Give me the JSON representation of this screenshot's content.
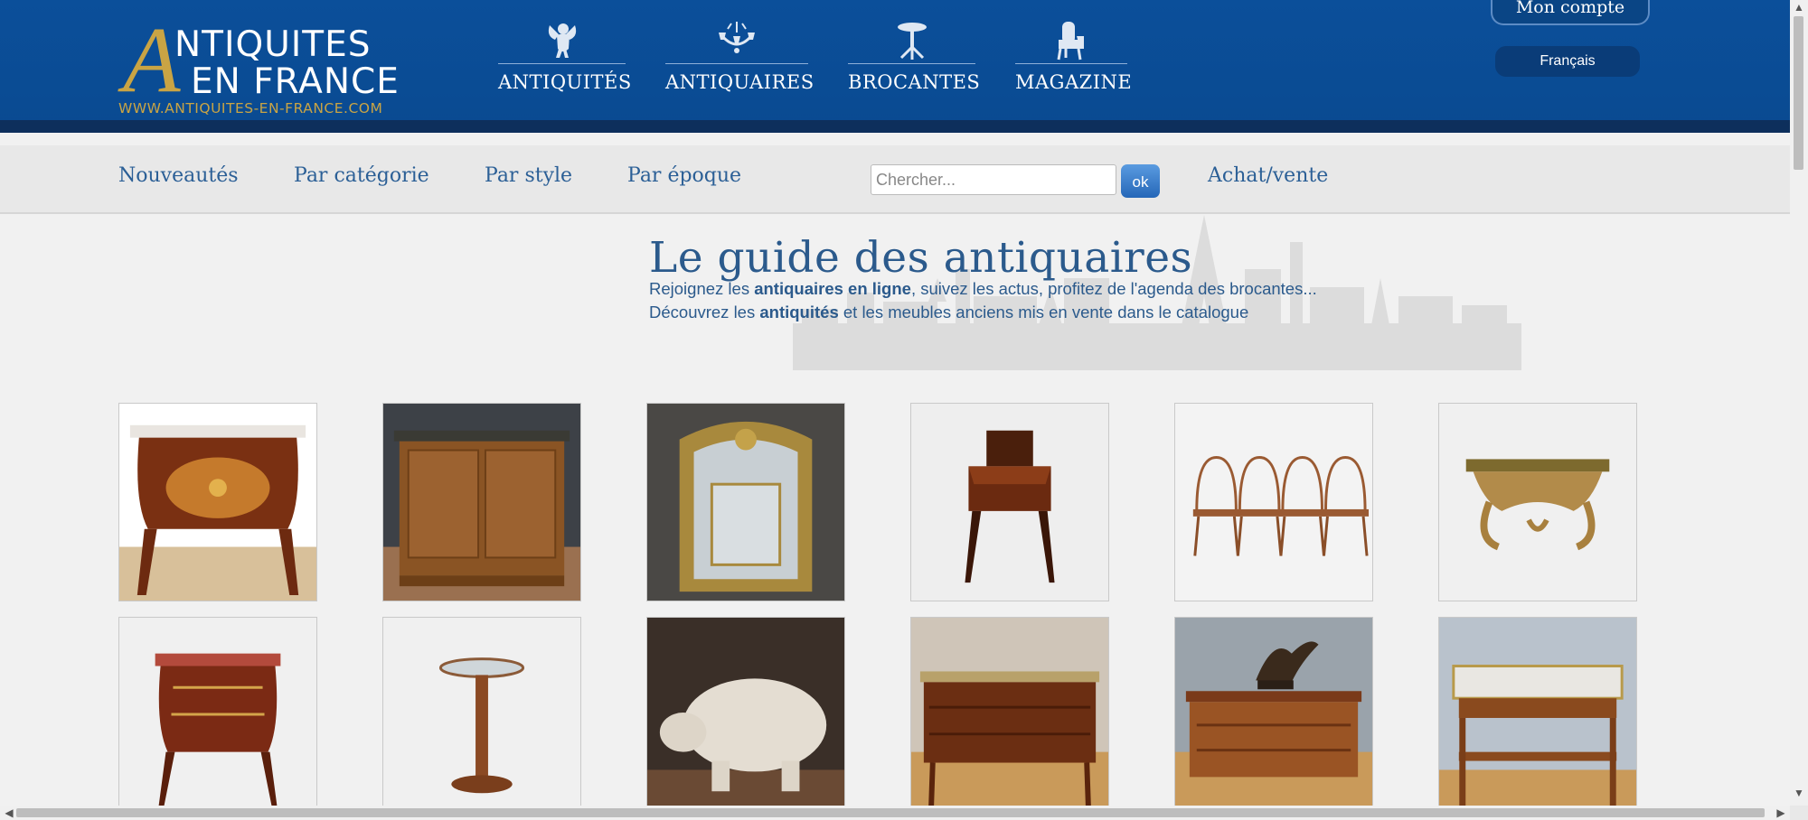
{
  "logo": {
    "initial": "A",
    "line1": "NTIQUITES",
    "line2": "EN FRANCE",
    "url": "WWW.ANTIQUITES-EN-FRANCE.COM"
  },
  "main_nav": [
    {
      "label": "ANTIQUITÉS",
      "icon": "cherub-icon"
    },
    {
      "label": "ANTIQUAIRES",
      "icon": "chandelier-icon"
    },
    {
      "label": "BROCANTES",
      "icon": "pedestal-table-icon"
    },
    {
      "label": "MAGAZINE",
      "icon": "armchair-icon"
    }
  ],
  "account": {
    "label": "Mon compte"
  },
  "language": {
    "selected": "Français"
  },
  "sub_nav": [
    {
      "label": "Nouveautés"
    },
    {
      "label": "Par catégorie"
    },
    {
      "label": "Par style"
    },
    {
      "label": "Par époque"
    },
    {
      "label": "Achat/vente"
    }
  ],
  "search": {
    "placeholder": "Chercher...",
    "value": "",
    "button_label": "ok"
  },
  "intro": {
    "title": "Le guide des antiquaires",
    "line1_pre": "Rejoignez les ",
    "line1_bold": "antiquaires en ligne",
    "line1_post": ", suivez les actus, profitez de l'agenda des brocantes...",
    "line2_pre": "Découvrez les ",
    "line2_bold": "antiquités",
    "line2_post": " et les meubles anciens mis en vente dans le catalogue"
  },
  "products": [
    {
      "name": "commode-louis-xv-marquetry"
    },
    {
      "name": "provincial-buffet"
    },
    {
      "name": "gilded-mirror"
    },
    {
      "name": "writing-desk"
    },
    {
      "name": "windsor-chairs"
    },
    {
      "name": "gilded-console"
    },
    {
      "name": "commode-rouge-marble"
    },
    {
      "name": "pedestal-gueridon"
    },
    {
      "name": "ceramic-pig"
    },
    {
      "name": "mahogany-chest-gallery"
    },
    {
      "name": "chest-with-bronze-statue"
    },
    {
      "name": "marble-top-side-table"
    }
  ],
  "colors": {
    "header": "#0b4f9a",
    "header_dark": "#0d2f5c",
    "gold": "#c9a444",
    "link": "#2b5f96",
    "button": "#2567b8"
  }
}
